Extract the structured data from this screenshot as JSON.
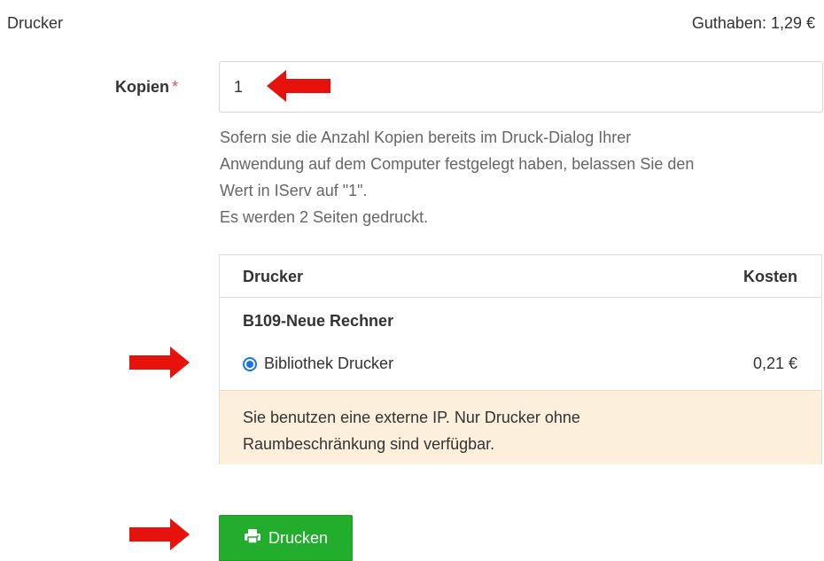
{
  "header": {
    "title": "Drucker",
    "balance": "Guthaben: 1,29 €"
  },
  "copies": {
    "label": "Kopien",
    "required_marker": "*",
    "value": "1",
    "help_lines": [
      "Sofern sie die Anzahl Kopien bereits im Druck-Dialog Ihrer",
      "Anwendung auf dem Computer festgelegt haben, belassen Sie den",
      "Wert in IServ auf \"1\".",
      "Es werden 2 Seiten gedruckt."
    ]
  },
  "printer_table": {
    "col_printer": "Drucker",
    "col_cost": "Kosten",
    "group": "B109-Neue Rechner",
    "rows": [
      {
        "name": "Bibliothek Drucker",
        "cost": "0,21 €",
        "selected": true
      }
    ],
    "warning_lines": [
      "Sie benutzen eine externe IP. Nur Drucker ohne",
      "Raumbeschränkung sind verfügbar."
    ]
  },
  "actions": {
    "print_label": "Drucken",
    "print_icon": "printer-icon"
  },
  "colors": {
    "accent_green": "#22ad2c",
    "radio_blue": "#1a73e8",
    "warning_bg": "#fcefdb",
    "annotation_arrow": "#e8120c"
  }
}
